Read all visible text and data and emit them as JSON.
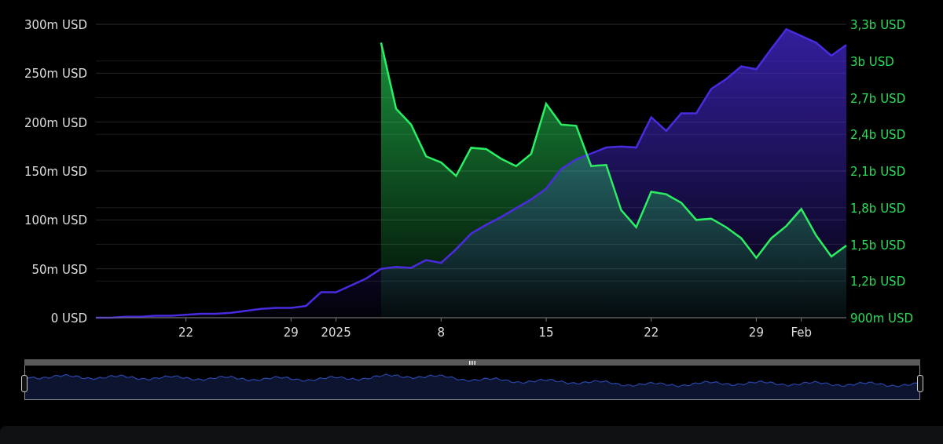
{
  "chart": {
    "chart_data": {
      "type": "area",
      "grid": true,
      "categories": [
        null,
        null,
        null,
        null,
        null,
        null,
        "22",
        null,
        null,
        null,
        null,
        null,
        null,
        "29",
        null,
        null,
        "2025",
        null,
        null,
        null,
        null,
        null,
        null,
        "8",
        null,
        null,
        null,
        null,
        null,
        null,
        "15",
        null,
        null,
        null,
        null,
        null,
        null,
        "22",
        null,
        null,
        null,
        null,
        null,
        null,
        "29",
        null,
        null,
        "Feb",
        null,
        null,
        null
      ],
      "ylim": [
        0,
        300
      ],
      "y2lim": [
        900000000,
        3300000000
      ],
      "series": [
        {
          "color": "#4a2be0",
          "values": [
            0,
            0,
            1,
            1,
            2,
            2,
            3,
            4,
            4,
            5,
            7,
            9,
            10,
            10,
            12,
            26,
            26,
            33,
            40,
            50,
            52,
            51,
            59,
            56,
            70,
            86,
            95,
            103,
            112,
            121,
            132,
            152,
            162,
            168,
            174,
            175,
            174,
            205,
            191,
            209,
            209,
            234,
            244,
            257,
            254,
            275,
            295,
            288,
            281,
            268,
            279
          ]
        },
        {
          "axis": "y2",
          "color": "#2bef63",
          "values": [
            null,
            null,
            null,
            null,
            null,
            null,
            null,
            null,
            null,
            null,
            null,
            null,
            null,
            null,
            null,
            null,
            null,
            null,
            null,
            3150000000,
            2610000000,
            2480000000,
            2220000000,
            2170000000,
            2060000000,
            2290000000,
            2280000000,
            2200000000,
            2140000000,
            2240000000,
            2650000000,
            2480000000,
            2470000000,
            2140000000,
            2150000000,
            1780000000,
            1640000000,
            1930000000,
            1910000000,
            1840000000,
            1700000000,
            1710000000,
            1640000000,
            1550000000,
            1390000000,
            1550000000,
            1650000000,
            1790000000,
            1570000000,
            1400000000,
            1490000000
          ]
        }
      ],
      "yticks": [
        {
          "value": 0,
          "label": "0 USD"
        },
        {
          "value": 50,
          "label": "50m USD"
        },
        {
          "value": 100,
          "label": "100m USD"
        },
        {
          "value": 150,
          "label": "150m USD"
        },
        {
          "value": 200,
          "label": "200m USD"
        },
        {
          "value": 250,
          "label": "250m USD"
        },
        {
          "value": 300,
          "label": "300m USD"
        }
      ],
      "y2ticks": [
        {
          "value": 900000000,
          "label": "900m USD"
        },
        {
          "value": 1200000000,
          "label": "1,2b USD"
        },
        {
          "value": 1500000000,
          "label": "1,5b USD"
        },
        {
          "value": 1800000000,
          "label": "1,8b USD"
        },
        {
          "value": 2100000000,
          "label": "2,1b USD"
        },
        {
          "value": 2400000000,
          "label": "2,4b USD"
        },
        {
          "value": 2700000000,
          "label": "2,7b USD"
        },
        {
          "value": 3000000000,
          "label": "3b USD"
        },
        {
          "value": 3300000000,
          "label": "3,3b USD"
        }
      ]
    },
    "range_slider": {
      "level": 1
    }
  }
}
